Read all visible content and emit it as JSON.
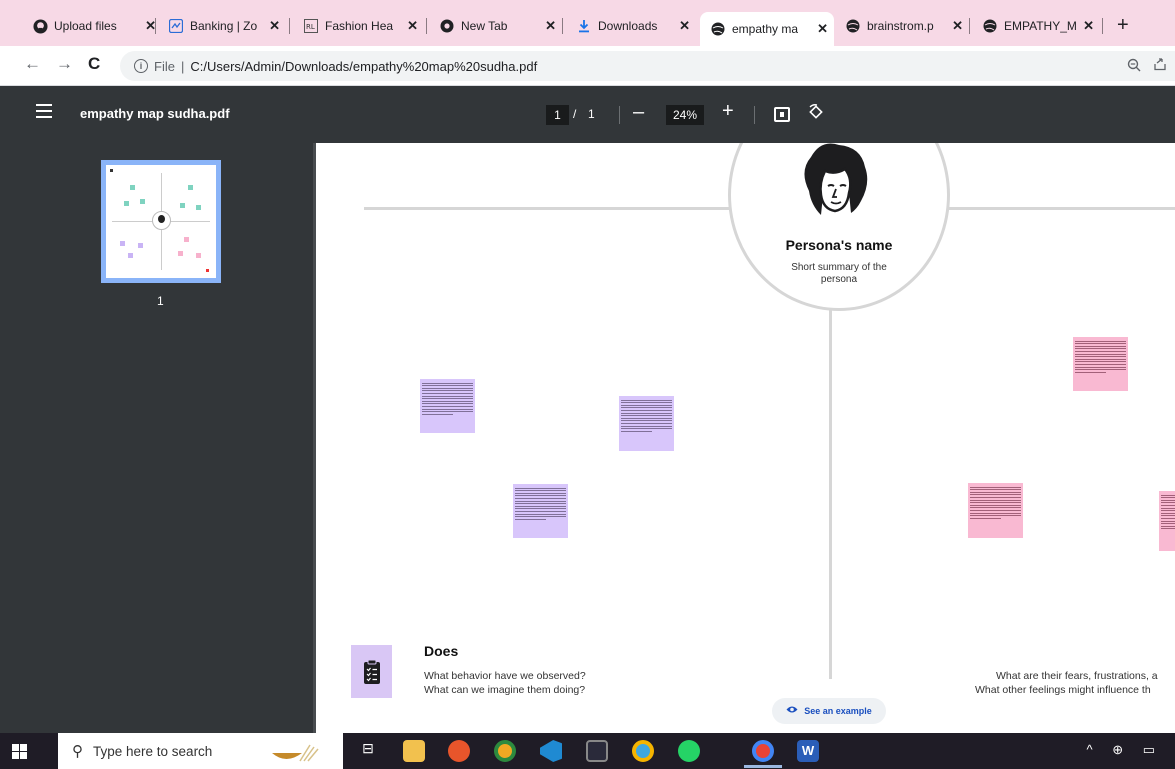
{
  "browser": {
    "tabs": [
      {
        "title": "Upload files",
        "icon": "github-icon"
      },
      {
        "title": "Banking | Zo",
        "icon": "banking-icon"
      },
      {
        "title": "Fashion Hea",
        "icon": "fashion-icon"
      },
      {
        "title": "New Tab",
        "icon": "chrome-icon"
      },
      {
        "title": "Downloads",
        "icon": "download-icon"
      },
      {
        "title": "empathy ma",
        "icon": "globe-icon",
        "active": true
      },
      {
        "title": "brainstrom.p",
        "icon": "globe-icon"
      },
      {
        "title": "EMPATHY_M",
        "icon": "globe-icon"
      }
    ],
    "new_tab_label": "+",
    "address": {
      "scheme": "File",
      "url": "C:/Users/Admin/Downloads/empathy%20map%20sudha.pdf"
    }
  },
  "pdf_viewer": {
    "title": "empathy map sudha.pdf",
    "page_current": "1",
    "page_separator": "/",
    "page_total": "1",
    "zoom": "24%",
    "thumbnail_label": "1"
  },
  "document": {
    "persona_name": "Persona's name",
    "persona_summary": "Short summary of the persona",
    "does": {
      "title": "Does",
      "question_1": "What behavior have we observed?",
      "question_2": "What can we imagine them doing?"
    },
    "feels": {
      "question_1": "What are their fears, frustrations, a",
      "question_2": "What other feelings might influence th"
    },
    "see_example": "See an example"
  },
  "taskbar": {
    "search_placeholder": "Type here to search"
  },
  "colors": {
    "tab_strip": "#f7d9e6",
    "pdf_toolbar": "#323639",
    "sticky_purple": "#d8c6fb",
    "sticky_pink": "#f9b9d2",
    "thumbnail_border": "#8ab4f8"
  }
}
